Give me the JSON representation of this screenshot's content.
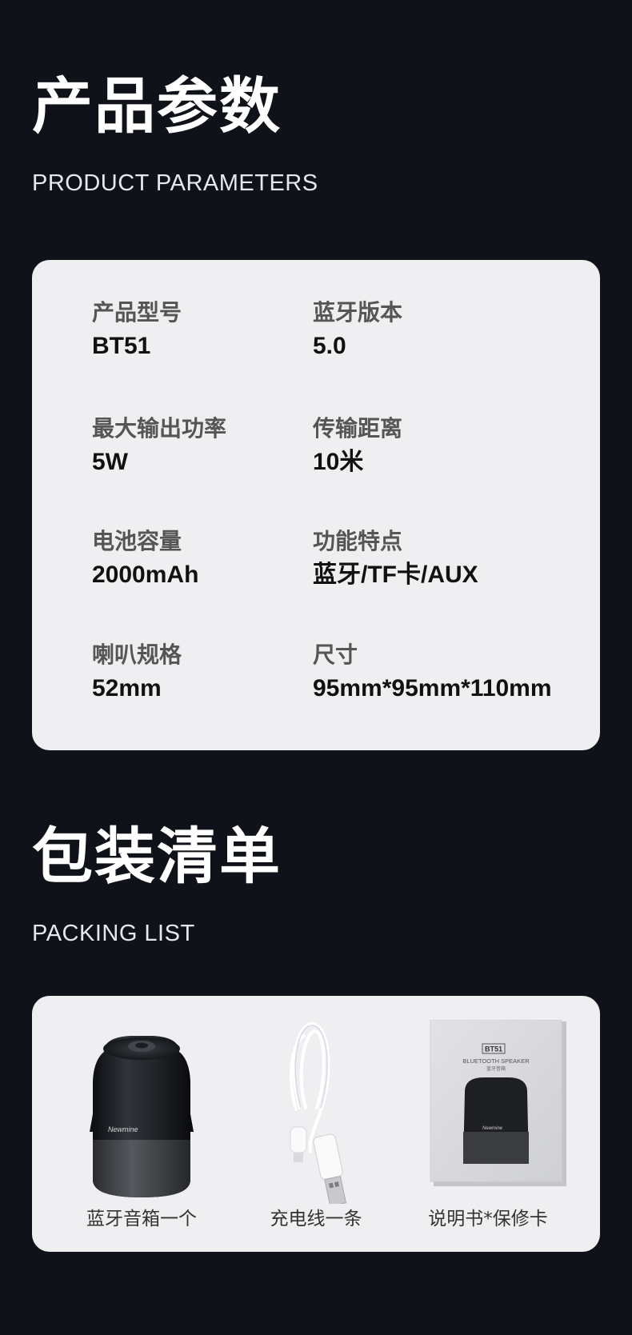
{
  "params_section": {
    "title_cn": "产品参数",
    "title_en": "PRODUCT PARAMETERS",
    "items": [
      {
        "label": "产品型号",
        "value": "BT51"
      },
      {
        "label": "蓝牙版本",
        "value": "5.0"
      },
      {
        "label": "最大输出功率",
        "value": "5W"
      },
      {
        "label": "传输距离",
        "value": "10米"
      },
      {
        "label": "电池容量",
        "value": "2000mAh"
      },
      {
        "label": "功能特点",
        "value": "蓝牙/TF卡/AUX"
      },
      {
        "label": "喇叭规格",
        "value": "52mm"
      },
      {
        "label": "尺寸",
        "value": "95mm*95mm*110mm"
      }
    ]
  },
  "packing_section": {
    "title_cn": "包装清单",
    "title_en": "PACKING LIST",
    "items": [
      {
        "label": "蓝牙音箱一个",
        "icon": "speaker-image"
      },
      {
        "label": "充电线一条",
        "icon": "usb-cable-image"
      },
      {
        "label": "说明书*保修卡",
        "icon": "manual-image"
      }
    ],
    "speaker_brand": "Newmine",
    "manual_model": "BT51",
    "manual_subtitle": "BLUETOOTH SPEAKER",
    "manual_subtitle_cn": "蓝牙音箱"
  },
  "colors": {
    "background": "#0f1218",
    "card": "#efeff1",
    "label": "#555555",
    "value": "#111111"
  }
}
